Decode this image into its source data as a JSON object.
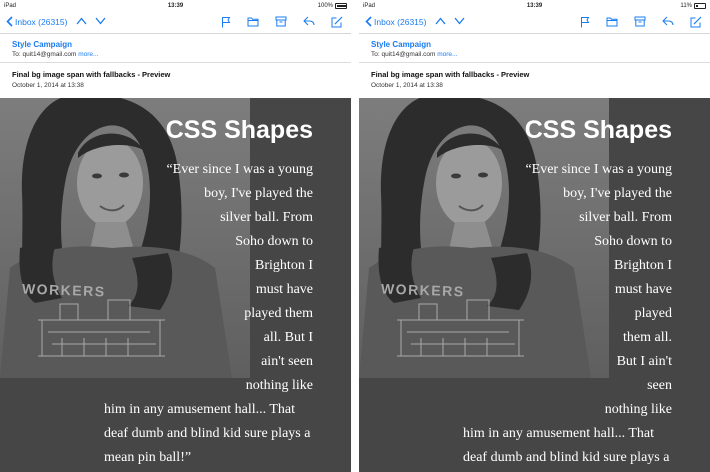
{
  "left": {
    "status": {
      "device": "iPad",
      "time": "13:39",
      "battery": "100%",
      "battery_level": 1.0
    },
    "inbox_label": "Inbox (26315)",
    "sender": "Style Campaign",
    "to_prefix": "To:",
    "to_address": "quit14@gmail.com",
    "more_label": "more...",
    "subject": "Final bg image span with fallbacks - Preview",
    "date": "October 1, 2014 at 13:38",
    "heading": "CSS Shapes",
    "shirt_text": "WORKERS",
    "quote_lines": [
      "“Ever since I was a young",
      "boy, I've played the",
      "silver ball. From",
      "Soho down to",
      "Brighton I",
      "must have",
      "played them",
      "all. But I",
      "ain't seen",
      "nothing like",
      "him in any amusement hall... That",
      "deaf dumb and blind kid sure plays a",
      "mean pin ball!”"
    ]
  },
  "right": {
    "status": {
      "device": "iPad",
      "time": "13:39",
      "battery": "11%",
      "battery_level": 0.11
    },
    "inbox_label": "Inbox (26315)",
    "sender": "Style Campaign",
    "to_prefix": "To:",
    "to_address": "quit14@gmail.com",
    "more_label": "more...",
    "subject": "Final bg image span with fallbacks - Preview",
    "date": "October 1, 2014 at 13:38",
    "heading": "CSS Shapes",
    "shirt_text": "WORKERS",
    "quote_lines": [
      "“Ever since I was a young",
      "boy, I've played the",
      "silver ball. From",
      "Soho down to",
      "Brighton I",
      "must have",
      "played",
      "them all.",
      "But I ain't",
      "seen",
      "nothing like",
      "him in any amusement hall... That",
      "deaf dumb and blind kid sure plays a"
    ]
  },
  "colors": {
    "accent": "#1a7cf2",
    "body_bg": "#464646"
  },
  "icons": [
    "chevron-left-icon",
    "chevron-up-icon",
    "chevron-down-icon",
    "flag-icon",
    "folder-icon",
    "archive-icon",
    "reply-icon",
    "compose-icon"
  ]
}
